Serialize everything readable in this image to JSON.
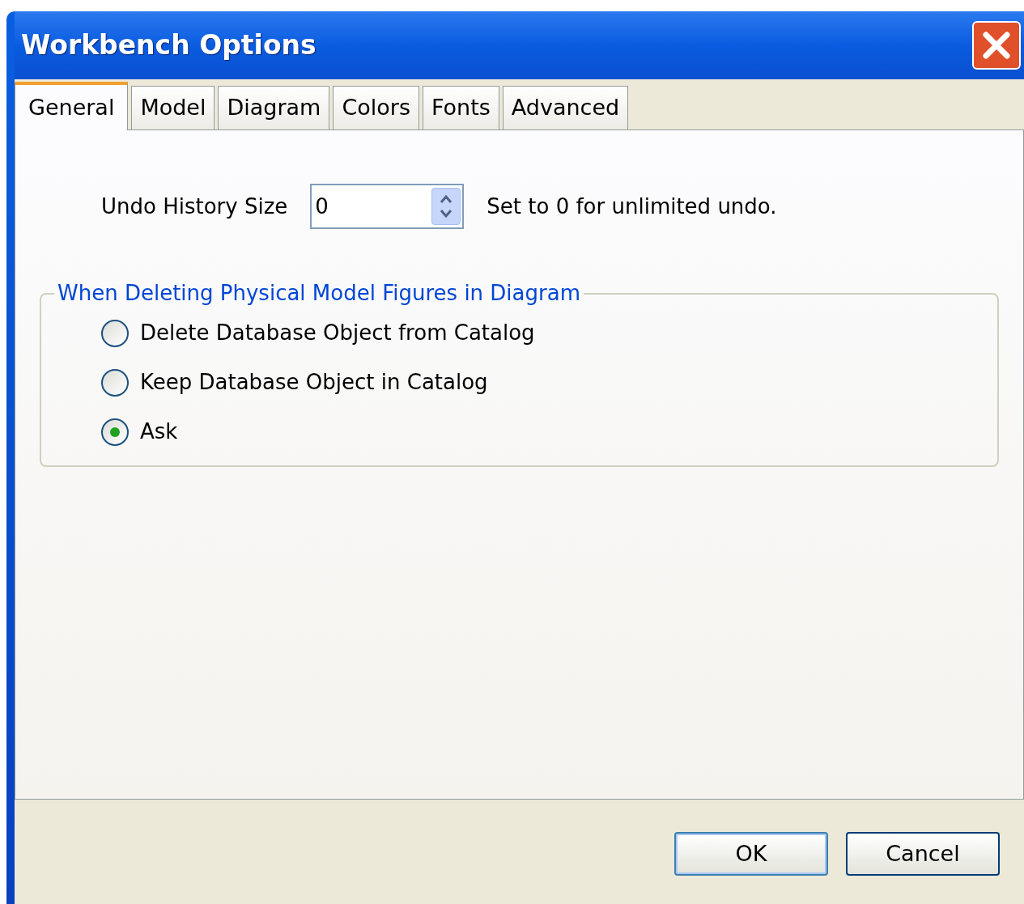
{
  "window": {
    "title": "Workbench Options"
  },
  "tabs": [
    {
      "label": "General",
      "selected": true
    },
    {
      "label": "Model",
      "selected": false
    },
    {
      "label": "Diagram",
      "selected": false
    },
    {
      "label": "Colors",
      "selected": false
    },
    {
      "label": "Fonts",
      "selected": false
    },
    {
      "label": "Advanced",
      "selected": false
    }
  ],
  "undo": {
    "label": "Undo History Size",
    "value": "0",
    "hint": "Set to 0 for unlimited undo."
  },
  "group": {
    "title": "When Deleting Physical Model Figures in Diagram",
    "options": [
      {
        "label": "Delete Database Object from Catalog",
        "selected": false
      },
      {
        "label": "Keep Database Object in Catalog",
        "selected": false
      },
      {
        "label": "Ask",
        "selected": true
      }
    ]
  },
  "buttons": [
    "OK",
    "Cancel"
  ]
}
